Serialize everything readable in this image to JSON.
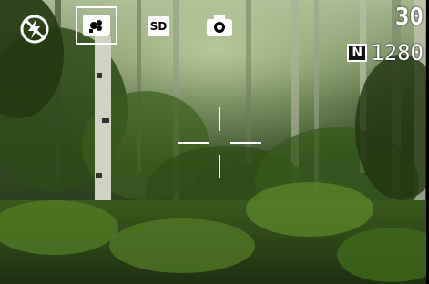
{
  "osd": {
    "flash_mode": "flash-off-auto-icon",
    "scene_mode": "portrait-flower-icon",
    "sd_card_label": "SD",
    "camera_mode": "camera-icon",
    "shots_remaining": "30",
    "quality_label": "N",
    "resolution": "1280"
  },
  "colors": {
    "osd_text": "#ffffff"
  }
}
